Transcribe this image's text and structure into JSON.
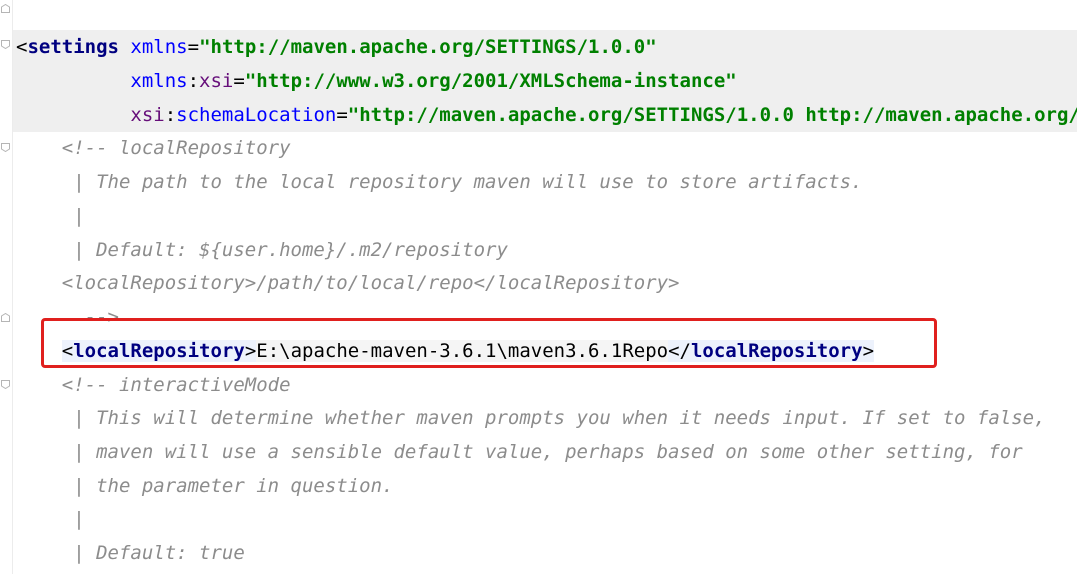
{
  "editor": {
    "lines": [
      {
        "comment": " |-->"
      },
      {
        "open_bracket": "<",
        "tag": "settings",
        "attr_name": "xmlns",
        "eq": "=",
        "attr_value": "\"http://maven.apache.org/SETTINGS/1.0.0\""
      },
      {
        "ns_prefix": "xmlns",
        "ns_colon": ":",
        "attr_name": "xsi",
        "eq": "=",
        "attr_value": "\"http://www.w3.org/2001/XMLSchema-instance\""
      },
      {
        "ns_prefix": "xsi",
        "ns_colon": ":",
        "attr_name": "schemaLocation",
        "eq": "=",
        "attr_value": "\"http://maven.apache.org/SETTINGS/1.0.0 http://maven.apache.org/xsd/settings-1.0.0.xsd\">"
      },
      {
        "comment": "<!-- localRepository"
      },
      {
        "comment": " | The path to the local repository maven will use to store artifacts."
      },
      {
        "comment": " |"
      },
      {
        "comment": " | Default: ${user.home}/.m2/repository"
      },
      {
        "comment": "<localRepository>/path/to/local/repo</localRepository>"
      },
      {
        "comment": "  -->"
      },
      {
        "open_tag_lt": "<",
        "open_tag": "localRepository",
        "open_tag_gt": ">",
        "text": "E:\\apache-maven-3.6.1\\maven3.6.1Repo",
        "close_tag_lt": "</",
        "close_tag": "localRepository",
        "close_tag_gt": ">"
      },
      {
        "comment": "<!-- interactiveMode"
      },
      {
        "comment": " | This will determine whether maven prompts you when it needs input. If set to false,"
      },
      {
        "comment": " | maven will use a sensible default value, perhaps based on some other setting, for"
      },
      {
        "comment": " | the parameter in question."
      },
      {
        "comment": " |"
      },
      {
        "comment": " | Default: true"
      }
    ]
  },
  "colors": {
    "highlight_box": "#e0201e",
    "comment": "#8c8c8c",
    "tag": "#000080",
    "attribute": "#0000ff",
    "namespace": "#660e7a",
    "string": "#008000",
    "current_line": "#efefef"
  },
  "icons": [
    "fold-start-icon",
    "fold-end-icon"
  ]
}
